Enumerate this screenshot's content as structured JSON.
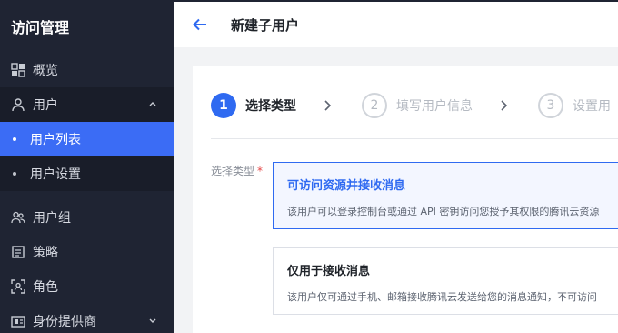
{
  "sidebar": {
    "brand": "访问管理",
    "items": [
      {
        "label": "概览"
      },
      {
        "label": "用户"
      },
      {
        "label": "用户组"
      },
      {
        "label": "策略"
      },
      {
        "label": "角色"
      },
      {
        "label": "身份提供商"
      }
    ],
    "sub_items": [
      {
        "label": "用户列表",
        "active": true
      },
      {
        "label": "用户设置",
        "active": false
      }
    ]
  },
  "header": {
    "title": "新建子用户"
  },
  "steps": [
    {
      "num": "1",
      "label": "选择类型",
      "active": true
    },
    {
      "num": "2",
      "label": "填写用户信息",
      "active": false
    },
    {
      "num": "3",
      "label": "设置用",
      "active": false
    }
  ],
  "form": {
    "field_label": "选择类型",
    "required_mark": "*",
    "options": [
      {
        "title": "可访问资源并接收消息",
        "desc": "该用户可以登录控制台或通过 API 密钥访问您授予其权限的腾讯云资源",
        "selected": true
      },
      {
        "title": "仅用于接收消息",
        "desc": "该用户仅可通过手机、邮箱接收腾讯云发送给您的消息通知，不可访问",
        "selected": false
      }
    ]
  },
  "colors": {
    "sidebar_bg": "#1f2433",
    "accent": "#2f6af1",
    "active_nav": "#3b6cf5"
  }
}
